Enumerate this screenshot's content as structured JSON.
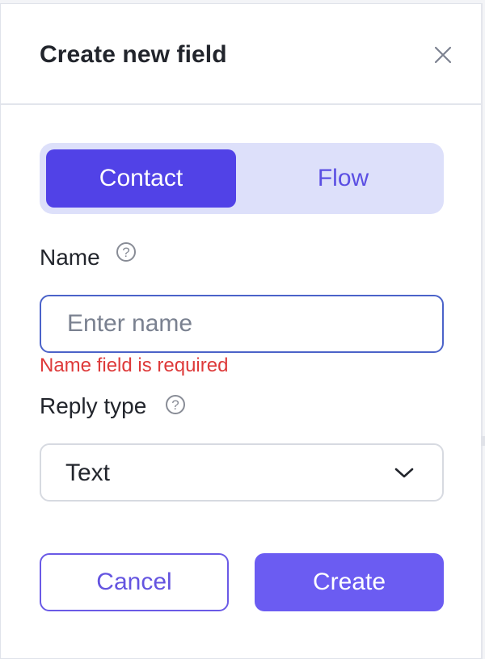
{
  "dialog": {
    "title": "Create new field"
  },
  "scope_toggle": {
    "options": [
      "Contact",
      "Flow"
    ],
    "selected": "Contact"
  },
  "name_field": {
    "label": "Name",
    "placeholder": "Enter name",
    "value": "",
    "error": "Name field is required"
  },
  "reply_type": {
    "label": "Reply type",
    "selected": "Text"
  },
  "actions": {
    "cancel": "Cancel",
    "create": "Create"
  },
  "icons": {
    "close": "close-icon",
    "help": "question-circle-icon",
    "dropdown": "chevron-down-icon"
  },
  "colors": {
    "accent": "#5142e7",
    "accent_light": "#dde0fa",
    "button_primary": "#6b5cf2",
    "error": "#de3a3a",
    "input_focus_border": "#4b63c9"
  }
}
